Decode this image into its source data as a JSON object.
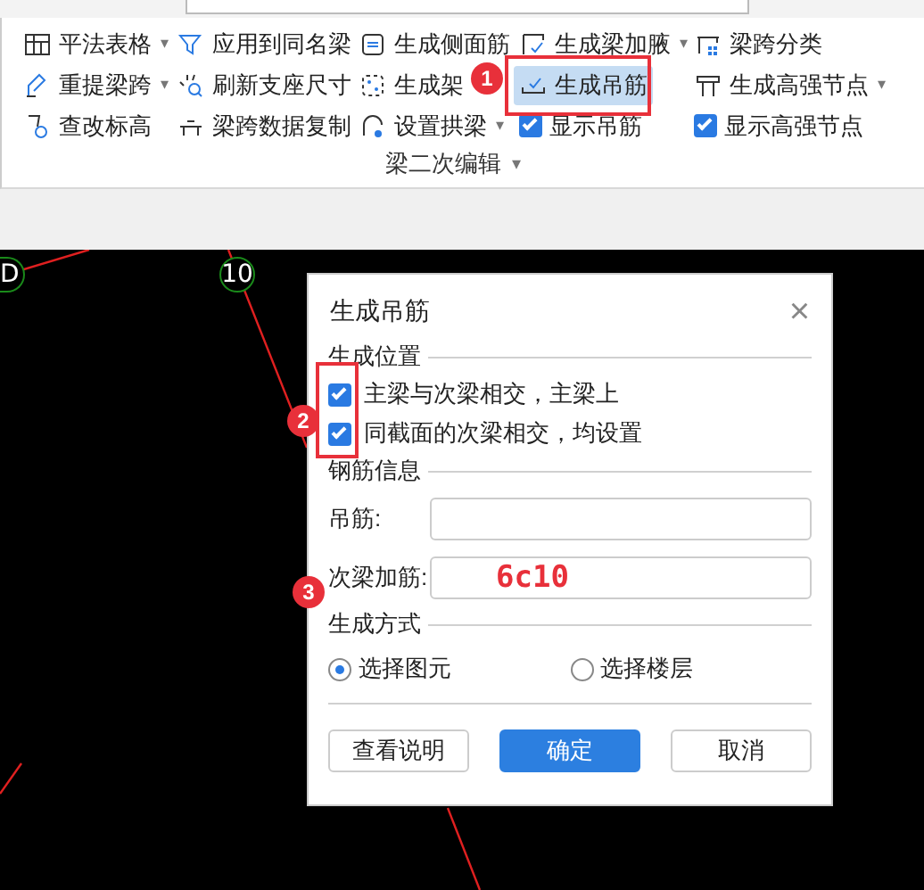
{
  "ribbon": {
    "rows": [
      [
        {
          "kind": "button",
          "label": "平法表格",
          "caret": "▾",
          "selected": false
        },
        {
          "kind": "button",
          "label": "应用到同名梁",
          "selected": false
        },
        {
          "kind": "button",
          "label": "生成侧面筋",
          "selected": false
        },
        {
          "kind": "button",
          "label": "生成梁加腋",
          "caret": "▾",
          "selected": false
        },
        {
          "kind": "button",
          "label": "梁跨分类",
          "selected": false
        }
      ],
      [
        {
          "kind": "button",
          "label": "重提梁跨",
          "caret": "▾",
          "selected": false
        },
        {
          "kind": "button",
          "label": "刷新支座尺寸",
          "selected": false
        },
        {
          "kind": "button",
          "label": "生成架",
          "selected": false
        },
        {
          "kind": "button",
          "label": "生成吊筋",
          "selected": true
        },
        {
          "kind": "button",
          "label": "生成高强节点",
          "caret": "▾",
          "selected": false
        }
      ],
      [
        {
          "kind": "button",
          "label": "查改标高",
          "selected": false
        },
        {
          "kind": "button",
          "label": "梁跨数据复制",
          "selected": false
        },
        {
          "kind": "button",
          "label": "设置拱梁",
          "caret": "▾",
          "selected": false
        },
        {
          "kind": "checkbox",
          "label": "显示吊筋",
          "checked": true
        },
        {
          "kind": "checkbox",
          "label": "显示高强节点",
          "checked": true
        }
      ]
    ],
    "group_label": "梁二次编辑",
    "group_caret": "▾"
  },
  "canvas": {
    "axis_labels": [
      "D",
      "10"
    ]
  },
  "dialog": {
    "title": "生成吊筋",
    "close": "×",
    "sections": [
      {
        "kind": "checkboxes",
        "title": "生成位置",
        "items": [
          {
            "label": "主梁与次梁相交，主梁上",
            "checked": true
          },
          {
            "label": "同截面的次梁相交，均设置",
            "checked": true
          }
        ]
      },
      {
        "kind": "fields",
        "title": "钢筋信息",
        "items": [
          {
            "label": "吊筋:"
          },
          {
            "label": "次梁加筋:",
            "value": "6c10"
          }
        ]
      },
      {
        "kind": "radios",
        "title": "生成方式",
        "items": [
          {
            "label": "选择图元",
            "selected": true
          },
          {
            "label": "选择楼层",
            "selected": false
          }
        ]
      }
    ],
    "buttons": [
      {
        "label": "查看说明",
        "primary": false
      },
      {
        "label": "确定",
        "primary": true
      },
      {
        "label": "取消",
        "primary": false
      }
    ]
  },
  "annotations": [
    {
      "label": "1"
    },
    {
      "label": "2"
    },
    {
      "label": "3"
    }
  ]
}
